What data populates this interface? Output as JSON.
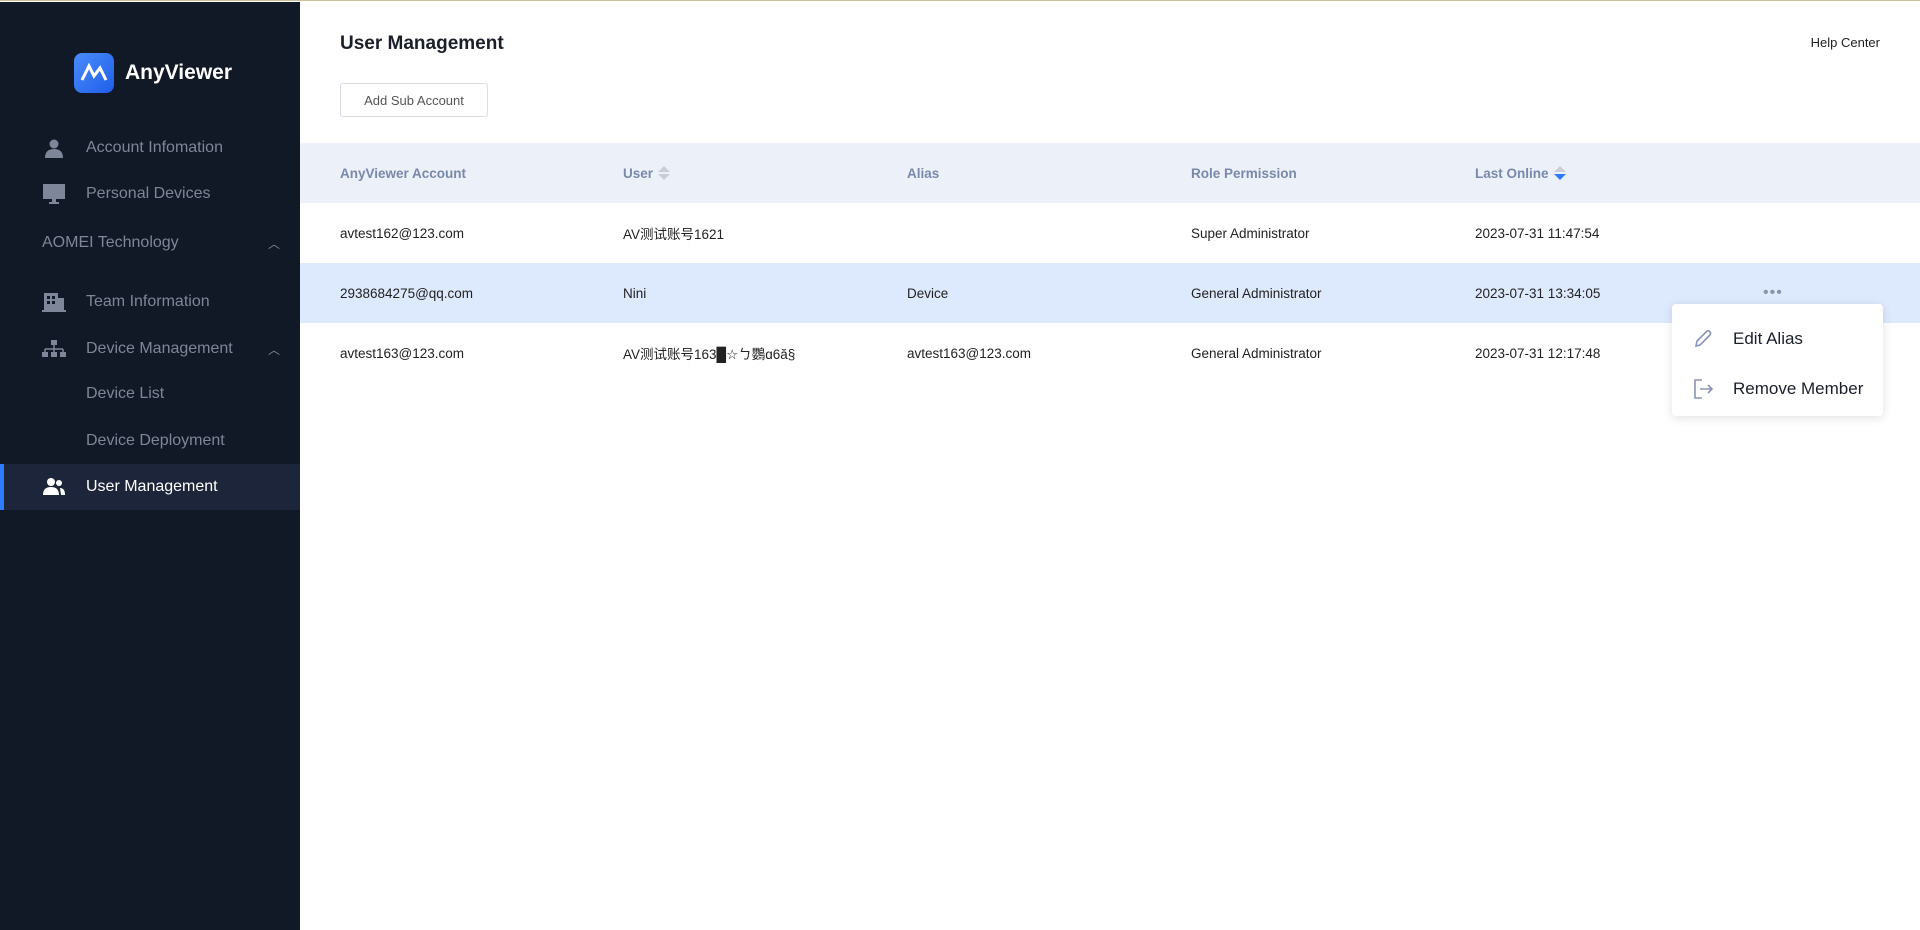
{
  "app": {
    "name": "AnyViewer"
  },
  "sidebar": {
    "items": [
      {
        "label": "Account Infomation",
        "icon": "user-icon"
      },
      {
        "label": "Personal Devices",
        "icon": "monitor-icon"
      },
      {
        "label": "AOMEI Technology"
      },
      {
        "label": "Team Information",
        "icon": "building-icon"
      },
      {
        "label": "Device Management",
        "icon": "sitemap-icon"
      },
      {
        "label": "Device List"
      },
      {
        "label": "Device Deployment"
      },
      {
        "label": "User Management",
        "icon": "users-icon"
      }
    ]
  },
  "header": {
    "title": "User Management",
    "help": "Help Center",
    "add_button": "Add Sub Account"
  },
  "table": {
    "columns": [
      "AnyViewer Account",
      "User",
      "Alias",
      "Role Permission",
      "Last Online"
    ],
    "rows": [
      [
        "avtest162@123.com",
        "AV测试账号1621",
        "",
        "Super Administrator",
        "2023-07-31 11:47:54"
      ],
      [
        "2938684275@qq.com",
        "Nini",
        "Device",
        "General Administrator",
        "2023-07-31 13:34:05"
      ],
      [
        "avtest163@123.com",
        "AV测试账号163█☆ㄅ鸚ɑ6ă§",
        "avtest163@123.com",
        "General Administrator",
        "2023-07-31 12:17:48"
      ]
    ],
    "more": "•••"
  },
  "context_menu": {
    "items": [
      {
        "label": "Edit Alias",
        "icon": "pencil-icon"
      },
      {
        "label": "Remove Member",
        "icon": "logout-icon"
      }
    ]
  },
  "colors": {
    "sidebar": "#111826",
    "accent": "#2f7bff",
    "header_bg": "#ecf0f8",
    "hover_row": "#dde9fd"
  }
}
